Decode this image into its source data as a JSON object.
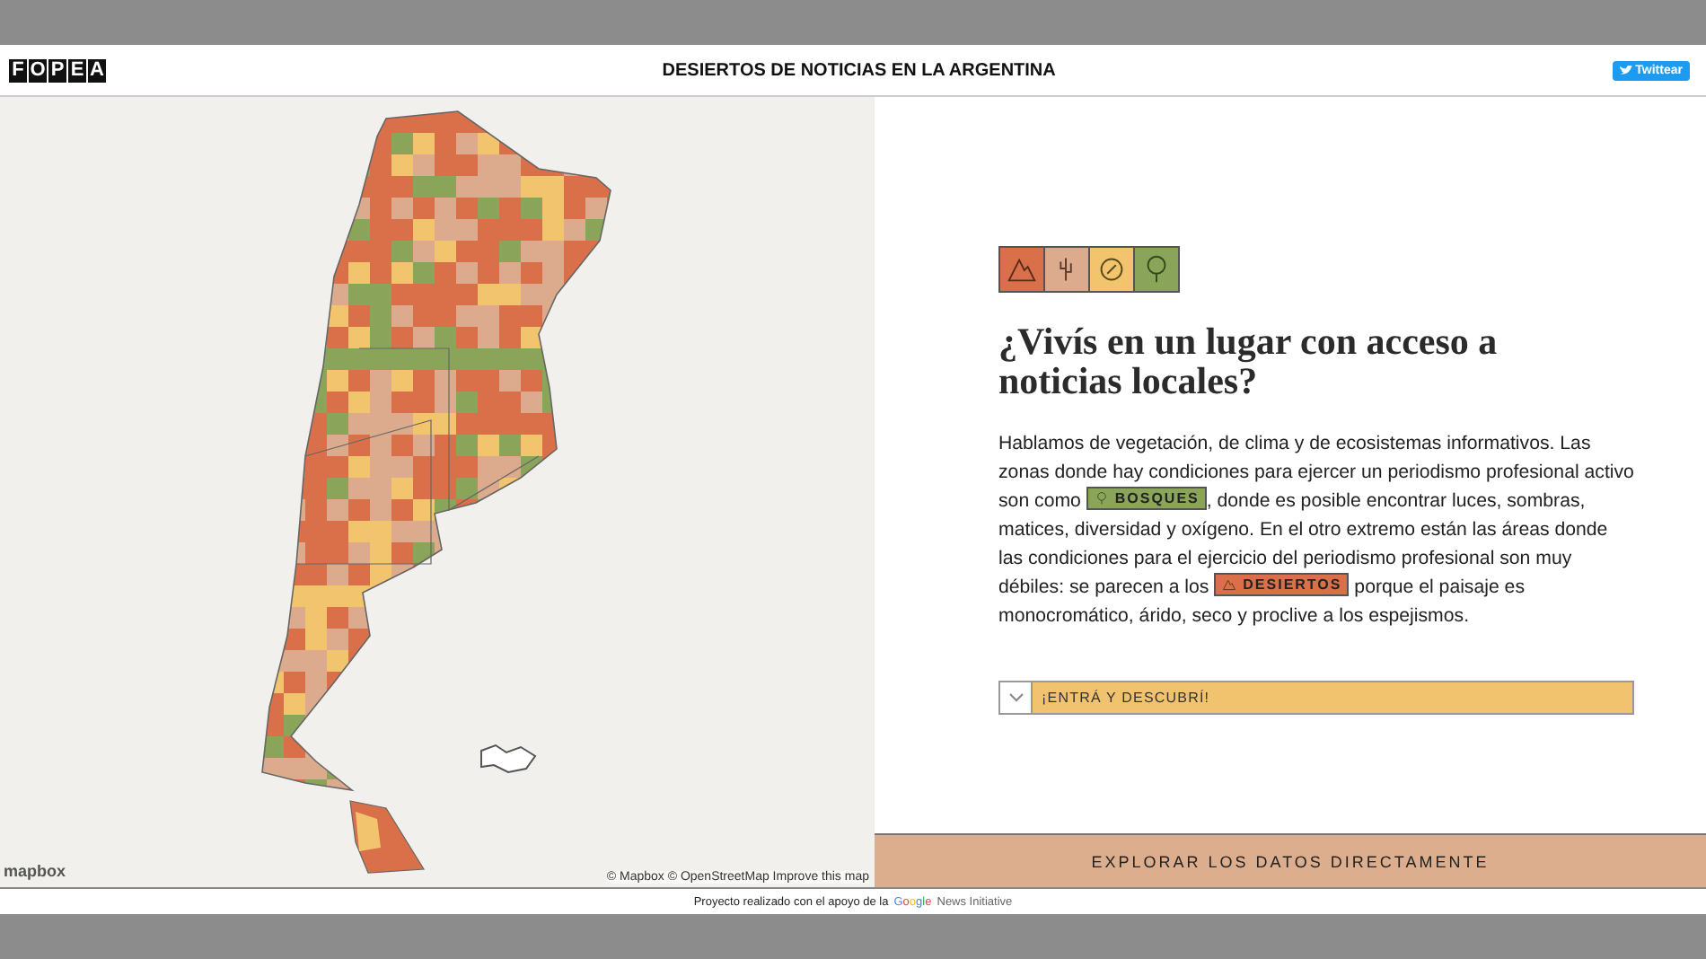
{
  "header": {
    "logo_letters": [
      "F",
      "O",
      "P",
      "E",
      "A"
    ],
    "title": "DESIERTOS DE NOTICIAS EN LA ARGENTINA",
    "share_button": "Twittear"
  },
  "map": {
    "logo": "mapbox",
    "attribution": "© Mapbox © OpenStreetMap Improve this map"
  },
  "legend": [
    {
      "kind": "desert",
      "color": "#d9704a"
    },
    {
      "kind": "cactus",
      "color": "#dcaa8c"
    },
    {
      "kind": "leaf",
      "color": "#f2c46e"
    },
    {
      "kind": "tree",
      "color": "#8aa55a"
    }
  ],
  "heading": "¿Vivís en un lugar con acceso a noticias locales?",
  "paragraph": [
    {
      "kind": "text",
      "text": "Hablamos de vegetación, de clima y de ecosistemas informativos. Las zonas donde hay condiciones para ejercer un periodismo profesional activo son como "
    },
    {
      "kind": "forest_tag",
      "text": "BOSQUES",
      "color": "#8aa55a"
    },
    {
      "kind": "text",
      "text": ", donde es posible encontrar luces, sombras, matices, diversidad y oxígeno. En el otro extremo están las áreas donde las condiciones para el ejercicio del periodismo profesional son muy débiles: se parecen a los "
    },
    {
      "kind": "desert_tag",
      "text": "DESIERTOS",
      "color": "#d9704a"
    },
    {
      "kind": "text",
      "text": " porque el paisaje es monocromático, árido, seco y proclive a los espejismos."
    }
  ],
  "accordion": {
    "label": "¡ENTRÁ Y DESCUBRÍ!",
    "expanded": false
  },
  "explore_button": "EXPLORAR LOS DATOS DIRECTAMENTE",
  "footer": {
    "text": "Proyecto realizado con el apoyo de la",
    "brand": "Google",
    "brand_suffix": "News Initiative"
  }
}
